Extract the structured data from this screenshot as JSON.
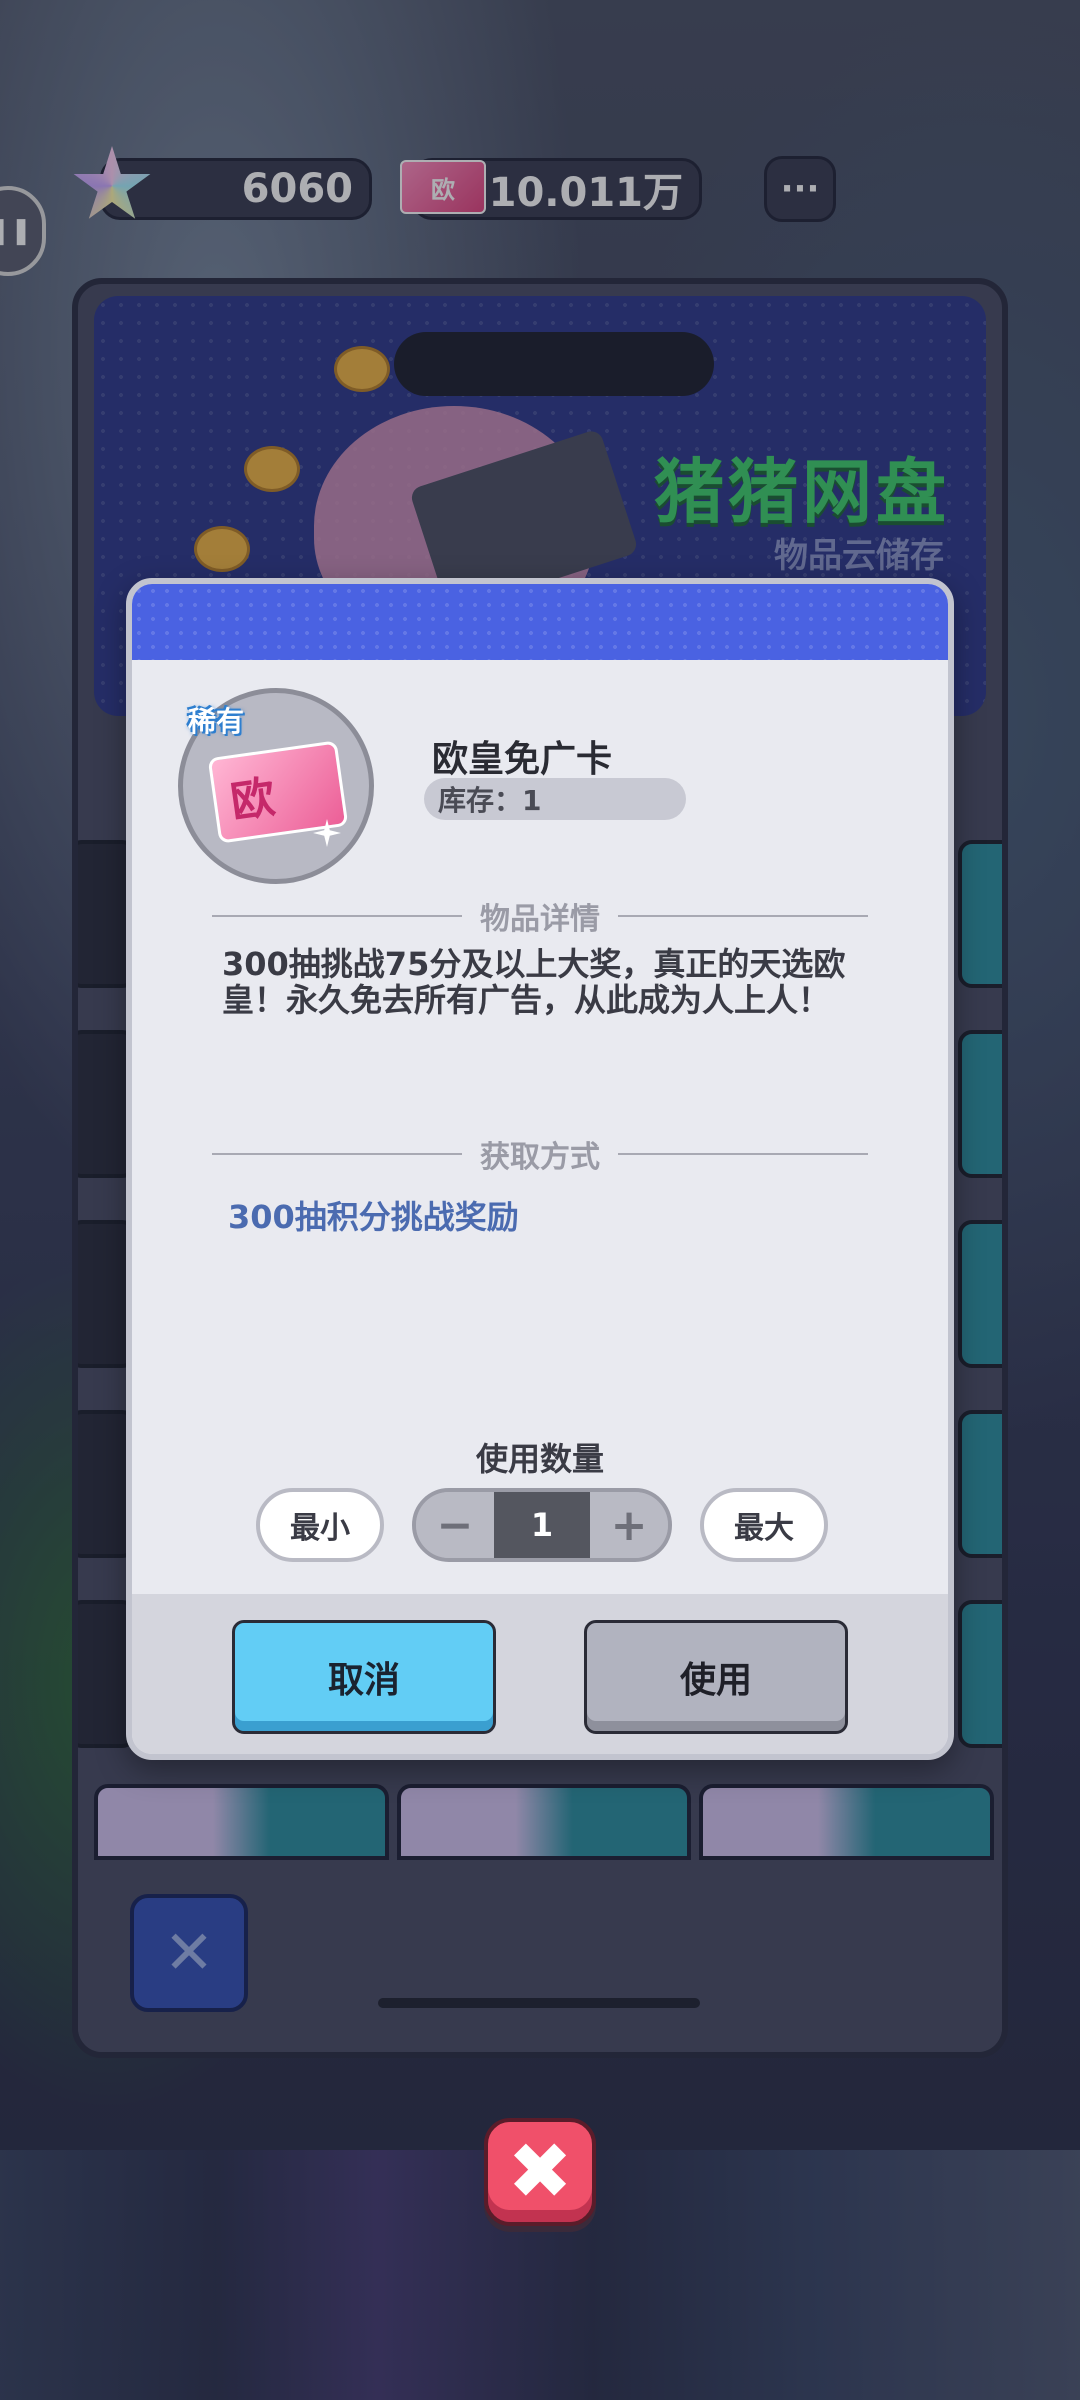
{
  "topbar": {
    "stars_value": "6060",
    "tickets_value": "10.011万",
    "more_label": "···",
    "ticket_icon_text": "欧"
  },
  "panel": {
    "brand_title": "猪猪网盘",
    "brand_subtitle": "物品云储存",
    "close_label": "✕"
  },
  "modal": {
    "rarity": "稀有",
    "item_icon_text": "欧",
    "item_name": "欧皇免广卡",
    "stock_label": "库存：1",
    "details_title": "物品详情",
    "description": "300抽挑战75分及以上大奖，真正的天选欧皇！永久免去所有广告，从此成为人上人！",
    "source_title": "获取方式",
    "source_text": "300抽积分挑战奖励",
    "quantity_label": "使用数量",
    "min_label": "最小",
    "max_label": "最大",
    "minus_label": "−",
    "plus_label": "+",
    "quantity_value": "1",
    "cancel_label": "取消",
    "use_label": "使用"
  },
  "big_close_label": "✖"
}
